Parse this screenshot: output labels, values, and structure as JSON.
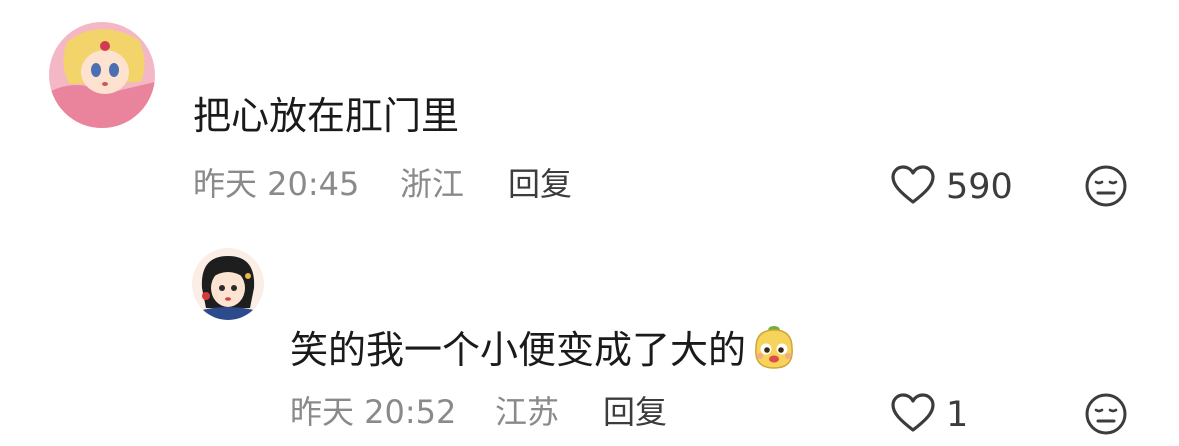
{
  "comments": [
    {
      "text": "把心放在肛门里",
      "time": "昨天 20:45",
      "location": "浙江",
      "reply_label": "回复",
      "likes": "590"
    },
    {
      "text": "笑的我一个小便变成了大的",
      "time": "昨天 20:52",
      "location": "江苏",
      "reply_label": "回复",
      "likes": "1"
    }
  ],
  "icons": {
    "like": "heart-outline-icon",
    "dislike": "neutral-face-icon",
    "emoji": "sticker-emoji-icon"
  },
  "colors": {
    "text": "#1a1a1a",
    "meta": "#8a8a8a",
    "action": "#3c3c3c"
  }
}
